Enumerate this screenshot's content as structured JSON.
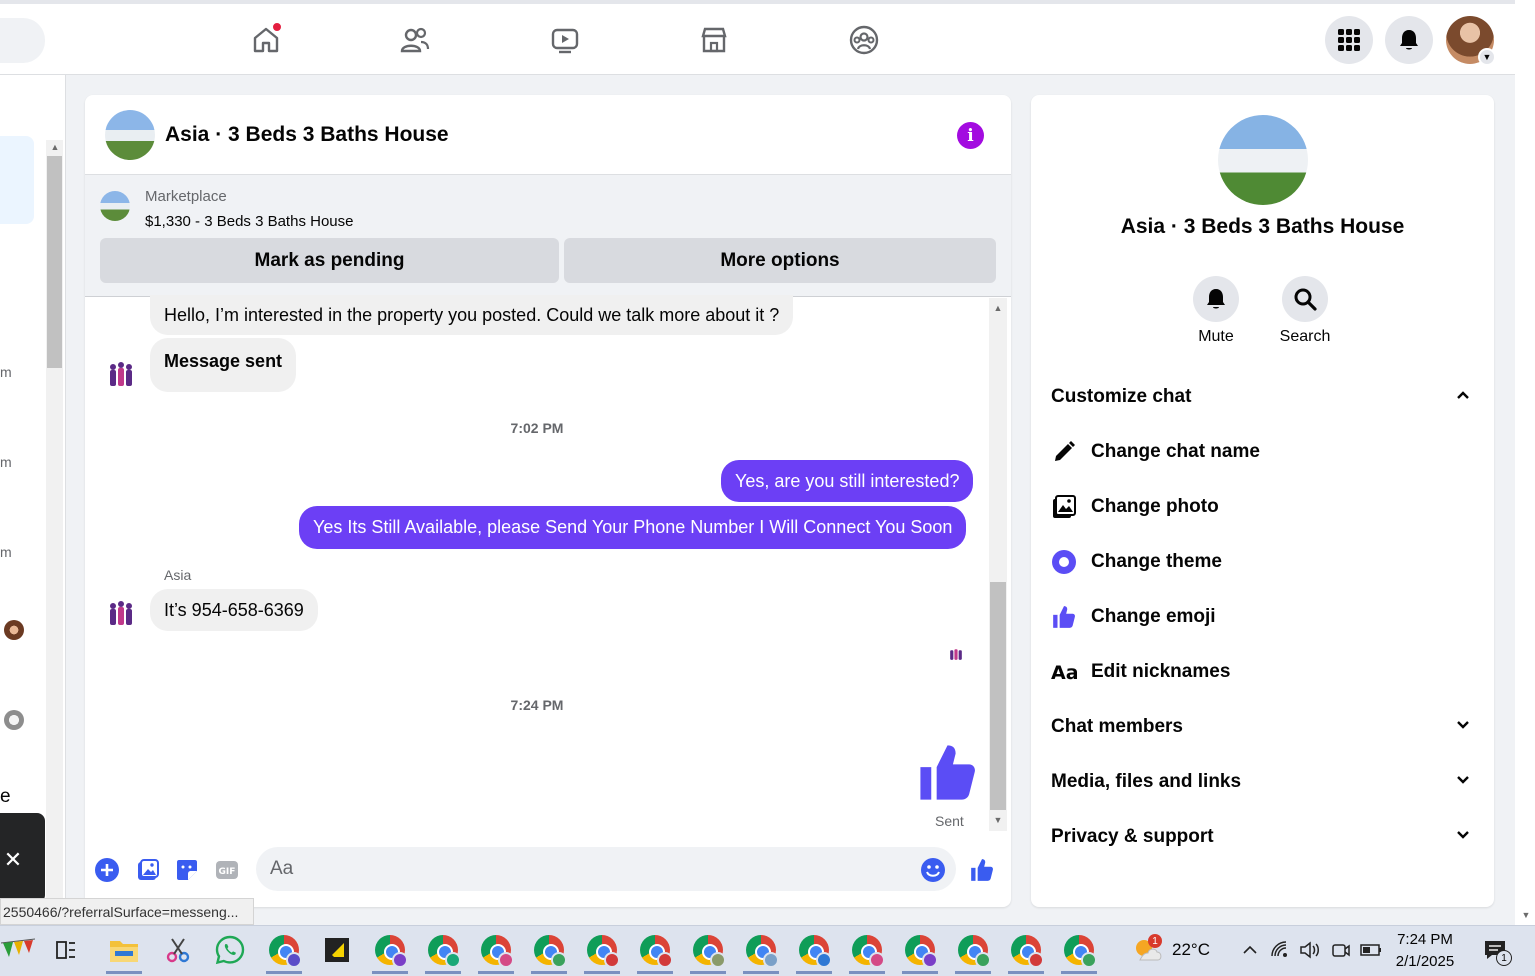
{
  "chat": {
    "title": "Asia · 3 Beds 3 Baths House",
    "marketplace_label": "Marketplace",
    "listing_price": "$1,330 - 3 Beds 3 Baths House",
    "mark_pending_label": "Mark as pending",
    "more_options_label": "More options",
    "messages": [
      {
        "from": "them",
        "text": "Hello, I’m interested in the property you posted. Could we talk more about it ?"
      },
      {
        "from": "them",
        "text": "Message sent",
        "bold": true
      },
      {
        "type": "timestamp",
        "text": "7:02 PM"
      },
      {
        "from": "me",
        "text": "Yes, are you still interested?"
      },
      {
        "from": "me",
        "text": "Yes Its Still Available, please Send Your Phone Number I Will Connect You Soon"
      },
      {
        "sender_name": "Asia"
      },
      {
        "from": "them",
        "text": "It’s 954-658-6369"
      },
      {
        "type": "timestamp",
        "text": "7:24 PM"
      },
      {
        "from": "me",
        "type": "like",
        "status": "Sent"
      }
    ],
    "composer_placeholder": "Aa"
  },
  "right_panel": {
    "title": "Asia · 3 Beds 3 Baths House",
    "actions": [
      {
        "label": "Mute",
        "icon": "bell-icon"
      },
      {
        "label": "Search",
        "icon": "search-icon"
      }
    ],
    "customize_label": "Customize chat",
    "customize_items": [
      {
        "label": "Change chat name",
        "icon": "pencil-icon"
      },
      {
        "label": "Change photo",
        "icon": "photo-icon"
      },
      {
        "label": "Change theme",
        "icon": "theme-icon"
      },
      {
        "label": "Change emoji",
        "icon": "thumbs-up-icon"
      },
      {
        "label": "Edit nicknames",
        "icon": "text-icon"
      }
    ],
    "sections": [
      "Chat members",
      "Media, files and links",
      "Privacy & support"
    ]
  },
  "left_sidebar": {
    "truncated_items": [
      "m",
      "m",
      "m",
      "e"
    ]
  },
  "status_url": "2550466/?referralSurface=messeng...",
  "taskbar": {
    "temperature": "22°C",
    "weather_badge": "1",
    "time": "7:24 PM",
    "date": "2/1/2025",
    "notification_count": "1"
  },
  "colors": {
    "accent": "#6c3ff5",
    "info": "#a30be0",
    "like": "#5b4df5"
  }
}
